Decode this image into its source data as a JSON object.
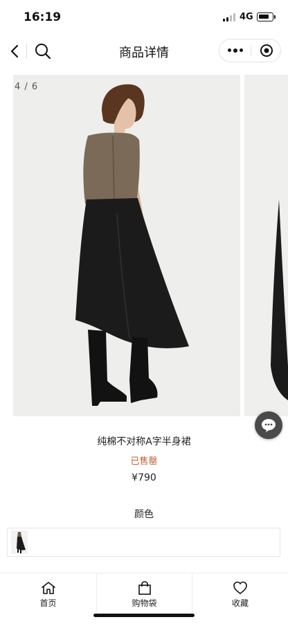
{
  "status_bar": {
    "time": "16:19",
    "network": "4G",
    "signal_bars": 2,
    "battery_level": 0.7
  },
  "nav": {
    "title": "商品详情"
  },
  "gallery": {
    "counter": "4 / 6",
    "current_index": 4,
    "total": 6
  },
  "product": {
    "name": "纯棉不对称A字半身裙",
    "status": "已售罄",
    "price": "¥790"
  },
  "options": {
    "color_label": "颜色"
  },
  "tabs": [
    {
      "label": "首页",
      "icon": "home-icon"
    },
    {
      "label": "购物袋",
      "icon": "bag-icon"
    },
    {
      "label": "收藏",
      "icon": "heart-icon"
    }
  ],
  "colors": {
    "sold_out": "#c0603a",
    "chat_button": "#4a4a4a",
    "image_background": "#eeeeec"
  }
}
